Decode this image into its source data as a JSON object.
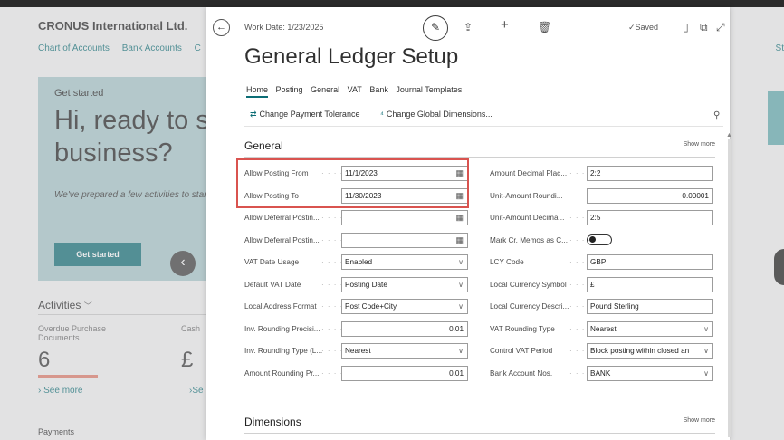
{
  "background": {
    "company": "CRONUS International Ltd.",
    "nav": [
      "Chart of Accounts",
      "Bank Accounts",
      "C"
    ],
    "nav_right": "St",
    "hero": {
      "get_started_label": "Get started",
      "headline": "Hi, ready to s business?",
      "subtext": "We've prepared a few activities to started.",
      "button": "Get started"
    },
    "activities_label": "Activities",
    "cues": [
      {
        "label": "Overdue Purchase Documents",
        "value": "6"
      },
      {
        "label": "Cash",
        "value": "£"
      }
    ],
    "see_more": "See more",
    "see_more2": "Se",
    "payments": "Payments"
  },
  "dialog": {
    "work_date": "Work Date: 1/23/2025",
    "saved": "Saved",
    "title": "General Ledger Setup",
    "tabs": [
      "Home",
      "Posting",
      "General",
      "VAT",
      "Bank",
      "Journal Templates"
    ],
    "actions": [
      {
        "label": "Change Payment Tolerance",
        "icon": "payment-tolerance-icon"
      },
      {
        "label": "Change Global Dimensions...",
        "icon": "dimensions-icon"
      }
    ],
    "general": {
      "header": "General",
      "show_more": "Show more",
      "left": [
        {
          "label": "Allow Posting From",
          "value": "11/1/2023",
          "type": "date"
        },
        {
          "label": "Allow Posting To",
          "value": "11/30/2023",
          "type": "date"
        },
        {
          "label": "Allow Deferral Postin...",
          "value": "",
          "type": "date"
        },
        {
          "label": "Allow Deferral Postin...",
          "value": "",
          "type": "date"
        },
        {
          "label": "VAT Date Usage",
          "value": "Enabled",
          "type": "select"
        },
        {
          "label": "Default VAT Date",
          "value": "Posting Date",
          "type": "select"
        },
        {
          "label": "Local Address Format",
          "value": "Post Code+City",
          "type": "select"
        },
        {
          "label": "Inv. Rounding Precisi...",
          "value": "0.01",
          "type": "number"
        },
        {
          "label": "Inv. Rounding Type (L...",
          "value": "Nearest",
          "type": "select"
        },
        {
          "label": "Amount Rounding Pr...",
          "value": "0.01",
          "type": "number"
        }
      ],
      "right": [
        {
          "label": "Amount Decimal Plac...",
          "value": "2:2",
          "type": "text"
        },
        {
          "label": "Unit-Amount Roundi...",
          "value": "0.00001",
          "type": "number"
        },
        {
          "label": "Unit-Amount Decima...",
          "value": "2:5",
          "type": "text"
        },
        {
          "label": "Mark Cr. Memos as C...",
          "value": "",
          "type": "toggle"
        },
        {
          "label": "LCY Code",
          "value": "GBP",
          "type": "text"
        },
        {
          "label": "Local Currency Symbol",
          "value": "£",
          "type": "text"
        },
        {
          "label": "Local Currency Descri...",
          "value": "Pound Sterling",
          "type": "text"
        },
        {
          "label": "VAT Rounding Type",
          "value": "Nearest",
          "type": "select"
        },
        {
          "label": "Control VAT Period",
          "value": "Block posting within closed an",
          "type": "select"
        },
        {
          "label": "Bank Account Nos.",
          "value": "BANK",
          "type": "select"
        }
      ]
    },
    "dimensions": {
      "header": "Dimensions",
      "show_more": "Show more"
    }
  },
  "colors": {
    "accent": "#0c6d75",
    "highlight": "#d9534f",
    "hero_bg": "#a9c9cb"
  }
}
